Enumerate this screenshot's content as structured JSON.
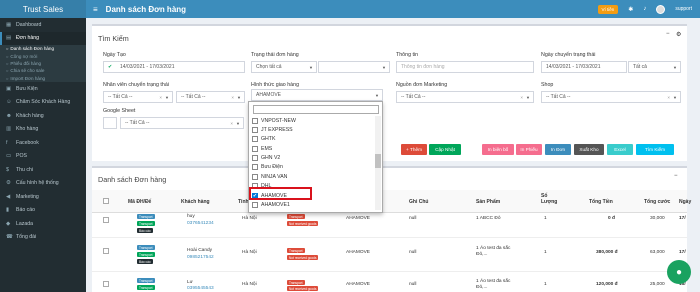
{
  "app": {
    "brand": "Trust Sales",
    "page_title": "Danh sách Đơn hàng",
    "wallet_label": "Ví tiền",
    "user": "support"
  },
  "sidebar": {
    "items": [
      {
        "label": "Dashboard",
        "icon": "dashboard-icon"
      },
      {
        "label": "Đơn hàng",
        "icon": "cart-icon"
      }
    ],
    "sub_items": [
      {
        "label": "Danh sách Đơn hàng"
      },
      {
        "label": "Công nợ mới"
      },
      {
        "label": "Phiếu đối hàng"
      },
      {
        "label": "Chia sẻ cho sale"
      },
      {
        "label": "Import Đơn hàng"
      }
    ],
    "more_items": [
      {
        "label": "Bưu Kiện",
        "icon": "package-icon"
      },
      {
        "label": "Chăm Sóc Khách Hàng",
        "icon": "support-icon"
      },
      {
        "label": "Khách hàng",
        "icon": "users-icon"
      },
      {
        "label": "Kho hàng",
        "icon": "warehouse-icon"
      },
      {
        "label": "Facebook",
        "icon": "facebook-icon"
      },
      {
        "label": "POS",
        "icon": "pos-icon"
      },
      {
        "label": "Thu chi",
        "icon": "money-icon"
      },
      {
        "label": "Cấu hình hệ thống",
        "icon": "gear-icon"
      },
      {
        "label": "Marketing",
        "icon": "megaphone-icon"
      },
      {
        "label": "Báo cáo",
        "icon": "chart-icon"
      },
      {
        "label": "Lazada",
        "icon": "shop-icon"
      },
      {
        "label": "Tổng đài",
        "icon": "phone-icon"
      }
    ]
  },
  "search": {
    "title": "Tìm Kiếm",
    "ngay_tao_label": "Ngày Tạo",
    "ngay_tao_value": "14/03/2021 - 17/03/2021",
    "trang_thai_label": "Trạng thái đơn hàng",
    "trang_thai_value": "Chọn tất cả",
    "thong_tin_label": "Thông tin",
    "thong_tin_placeholder": "Thông tin đơn hàng",
    "ngay_chuyen_label": "Ngày chuyển trạng thái",
    "ngay_chuyen_value": "14/03/2021 - 17/03/2021",
    "ngay_chuyen_select": "Tất cả",
    "nhan_vien_label": "Nhân viên chuyển trạng thái",
    "tat_ca_1": "-- Tất Cả --",
    "tat_ca_2": "-- Tất Cả --",
    "hinh_thuc_label": "Hình thức giao hàng",
    "hinh_thuc_value": "AHAMOVE",
    "nguon_label": "Nguồn đơn Marketing",
    "nguon_value": "-- Tất Cả --",
    "shop_label": "Shop",
    "shop_value": "-- Tất Cả --",
    "google_sheet_label": "Google Sheet",
    "google_sheet_value": "-- Tất Cả --"
  },
  "actions": [
    {
      "label": "+ Thêm",
      "color": "#dd4b39"
    },
    {
      "label": "Cập Nhật",
      "color": "#00a65a"
    },
    {
      "label": "In biên bố",
      "color": "#f56d8e"
    },
    {
      "label": "In Phiếu",
      "color": "#f56d8e"
    },
    {
      "label": "In Đơn",
      "color": "#3c8dbc"
    },
    {
      "label": "Xuất Kho",
      "color": "#555555"
    },
    {
      "label": "Excel",
      "color": "#39cccc"
    },
    {
      "label": "Tìm Kiếm",
      "color": "#00c0ef"
    }
  ],
  "shipping_options": [
    {
      "label": "VNPOST-NEW",
      "checked": false
    },
    {
      "label": "JT EXPRESS",
      "checked": false
    },
    {
      "label": "GHTK",
      "checked": false
    },
    {
      "label": "EMS",
      "checked": false
    },
    {
      "label": "GHN V2",
      "checked": false
    },
    {
      "label": "Bưu Điện",
      "checked": false
    },
    {
      "label": "NINJA VAN",
      "checked": false
    },
    {
      "label": "DHL",
      "checked": false
    },
    {
      "label": "AHAMOVE",
      "checked": true
    },
    {
      "label": "AHAMOVE1",
      "checked": false
    }
  ],
  "orders": {
    "title": "Danh sách Đơn hàng",
    "headers": [
      "Mã ĐH/Đế",
      "Khách hàng",
      "Tỉnh",
      "Ghi Chú",
      "Sản Phẩm",
      "Số Lượng",
      "Tổng Tiền",
      "Tổng cước",
      "Ngày"
    ],
    "rows": [
      {
        "customer": "huy",
        "phone": "0376541234",
        "city": "Hà Nội",
        "carrier": "AHAMOVE",
        "note": "null",
        "product": "1 ABCC Đỏ",
        "qty": "1",
        "total": "0 đ",
        "fee": "30,000",
        "date": "17/"
      },
      {
        "customer": "Hoài Candy",
        "phone": "0985217542",
        "city": "Hà Nội",
        "carrier": "AHAMOVE",
        "note": "null",
        "product": "1 Áo test đa sắc Đỏ,...",
        "qty": "1",
        "total": "380,000 đ",
        "fee": "63,000",
        "date": "17/"
      },
      {
        "customer": "Lư",
        "phone": "0395545543",
        "city": "Hà Nội",
        "carrier": "AHAMOVE",
        "note": "null",
        "product": "1 Áo test đa sắc Đỏ,...",
        "qty": "1",
        "total": "120,000 đ",
        "fee": "25,000",
        "date": "16/"
      }
    ],
    "tags": {
      "code": "Transport",
      "status": "Not received goods",
      "blue": "Báo cáo"
    }
  }
}
